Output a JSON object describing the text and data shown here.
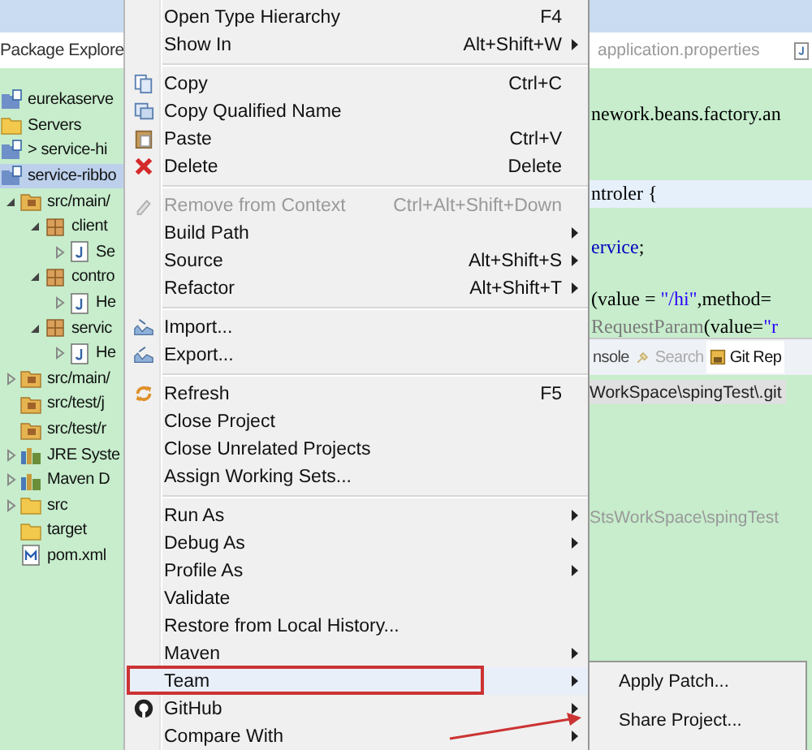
{
  "explorer": {
    "title": "Package Explore",
    "tree": [
      {
        "label": "eurekaserve",
        "kind": "project",
        "selected": false
      },
      {
        "label": "Servers",
        "kind": "folder",
        "selected": false
      },
      {
        "label": "> service-hi",
        "kind": "project",
        "selected": false
      },
      {
        "label": "service-ribbo",
        "kind": "project",
        "selected": true,
        "children": [
          {
            "label": "src/main/",
            "kind": "source-folder",
            "selected": false,
            "expanded": true,
            "children": [
              {
                "label": "client",
                "kind": "package",
                "selected": false,
                "expanded": true,
                "children": [
                  {
                    "label": "Se",
                    "kind": "java-file",
                    "selected": false,
                    "expanded": false
                  }
                ]
              },
              {
                "label": "contro",
                "kind": "package",
                "selected": false,
                "expanded": true,
                "children": [
                  {
                    "label": "He",
                    "kind": "java-file",
                    "selected": false,
                    "expanded": false
                  }
                ]
              },
              {
                "label": "servic",
                "kind": "package",
                "selected": false,
                "expanded": true,
                "children": [
                  {
                    "label": "He",
                    "kind": "java-file",
                    "selected": false,
                    "expanded": false
                  }
                ]
              }
            ]
          },
          {
            "label": "src/main/",
            "kind": "source-folder",
            "selected": false,
            "expanded": false
          },
          {
            "label": "src/test/j",
            "kind": "source-folder",
            "selected": false
          },
          {
            "label": "src/test/r",
            "kind": "source-folder",
            "selected": false
          },
          {
            "label": "JRE Syste",
            "kind": "library",
            "selected": false,
            "expanded": false
          },
          {
            "label": "Maven D",
            "kind": "library",
            "selected": false,
            "expanded": false
          },
          {
            "label": "src",
            "kind": "folder",
            "selected": false,
            "expanded": false
          },
          {
            "label": "target",
            "kind": "folder",
            "selected": false
          },
          {
            "label": "pom.xml",
            "kind": "xml-file",
            "selected": false
          }
        ]
      }
    ]
  },
  "context_menu": {
    "sections": [
      [
        {
          "label": "Open Type Hierarchy",
          "shortcut": "F4",
          "submenu": false,
          "disabled": false,
          "selected": false
        },
        {
          "label": "Show In",
          "shortcut": "Alt+Shift+W",
          "submenu": true,
          "disabled": false,
          "selected": false
        }
      ],
      [
        {
          "label": "Copy",
          "shortcut": "Ctrl+C",
          "kind": "copy",
          "submenu": false,
          "disabled": false,
          "selected": false
        },
        {
          "label": "Copy Qualified Name",
          "kind": "copy-name",
          "submenu": false,
          "disabled": false,
          "selected": false
        },
        {
          "label": "Paste",
          "shortcut": "Ctrl+V",
          "kind": "paste",
          "submenu": false,
          "disabled": false,
          "selected": false
        },
        {
          "label": "Delete",
          "shortcut": "Delete",
          "kind": "delete",
          "submenu": false,
          "disabled": false,
          "selected": false
        }
      ],
      [
        {
          "label": "Remove from Context",
          "shortcut": "Ctrl+Alt+Shift+Down",
          "kind": "remove",
          "submenu": false,
          "disabled": true,
          "selected": false
        },
        {
          "label": "Build Path",
          "submenu": true,
          "disabled": false,
          "selected": false
        },
        {
          "label": "Source",
          "shortcut": "Alt+Shift+S",
          "submenu": true,
          "disabled": false,
          "selected": false
        },
        {
          "label": "Refactor",
          "shortcut": "Alt+Shift+T",
          "submenu": true,
          "disabled": false,
          "selected": false
        }
      ],
      [
        {
          "label": "Import...",
          "kind": "import",
          "submenu": false,
          "disabled": false,
          "selected": false
        },
        {
          "label": "Export...",
          "kind": "export",
          "submenu": false,
          "disabled": false,
          "selected": false
        }
      ],
      [
        {
          "label": "Refresh",
          "shortcut": "F5",
          "kind": "refresh",
          "submenu": false,
          "disabled": false,
          "selected": false
        },
        {
          "label": "Close Project",
          "submenu": false,
          "disabled": false,
          "selected": false
        },
        {
          "label": "Close Unrelated Projects",
          "submenu": false,
          "disabled": false,
          "selected": false
        },
        {
          "label": "Assign Working Sets...",
          "submenu": false,
          "disabled": false,
          "selected": false
        }
      ],
      [
        {
          "label": "Run As",
          "submenu": true,
          "disabled": false,
          "selected": false
        },
        {
          "label": "Debug As",
          "submenu": true,
          "disabled": false,
          "selected": false
        },
        {
          "label": "Profile As",
          "submenu": true,
          "disabled": false,
          "selected": false
        },
        {
          "label": "Validate",
          "submenu": false,
          "disabled": false,
          "selected": false
        },
        {
          "label": "Restore from Local History...",
          "submenu": false,
          "disabled": false,
          "selected": false
        },
        {
          "label": "Maven",
          "submenu": true,
          "disabled": false,
          "selected": false
        },
        {
          "label": "Team",
          "submenu": true,
          "disabled": false,
          "selected": true
        },
        {
          "label": "GitHub",
          "kind": "github",
          "submenu": true,
          "disabled": false,
          "selected": false
        },
        {
          "label": "Compare With",
          "submenu": true,
          "disabled": false,
          "selected": false
        }
      ]
    ]
  },
  "submenu": {
    "items": [
      {
        "label": "Apply Patch..."
      },
      {
        "label": "Share Project..."
      }
    ]
  },
  "editor": {
    "tab": "application.properties",
    "lines": [
      {
        "highlighted": false,
        "tokens": [
          {
            "text": "nework.beans.factory.an",
            "kind": "plain"
          }
        ]
      },
      {
        "highlighted": false
      },
      {
        "highlighted": false
      },
      {
        "highlighted": true,
        "tokens": [
          {
            "text": "ntroler {",
            "kind": "plain"
          }
        ]
      },
      {
        "highlighted": false
      },
      {
        "highlighted": false,
        "tokens": [
          {
            "text": "ervice",
            "kind": "field"
          },
          {
            "text": ";",
            "kind": "plain"
          }
        ]
      },
      {
        "highlighted": false
      },
      {
        "highlighted": false,
        "tokens": [
          {
            "text": "(value = ",
            "kind": "plain"
          },
          {
            "text": "\"/hi\"",
            "kind": "string"
          },
          {
            "text": ",method=",
            "kind": "plain"
          }
        ]
      },
      {
        "highlighted": false,
        "tokens": [
          {
            "text": "RequestParam",
            "kind": "annotation"
          },
          {
            "text": "(value=",
            "kind": "plain"
          },
          {
            "text": "\"r",
            "kind": "string"
          }
        ]
      }
    ]
  },
  "bottom_panel": {
    "tabs": [
      {
        "label": "nsole",
        "kind": "plain",
        "selected": false
      },
      {
        "label": "Search",
        "kind": "search",
        "selected": false
      },
      {
        "label": "Git Rep",
        "kind": "git",
        "selected": true
      }
    ],
    "rows": [
      {
        "text": "WorkSpace\\spingTest\\.git",
        "selected": true
      },
      {
        "text": "StsWorkSpace\\spingTest",
        "selected": false
      }
    ]
  }
}
